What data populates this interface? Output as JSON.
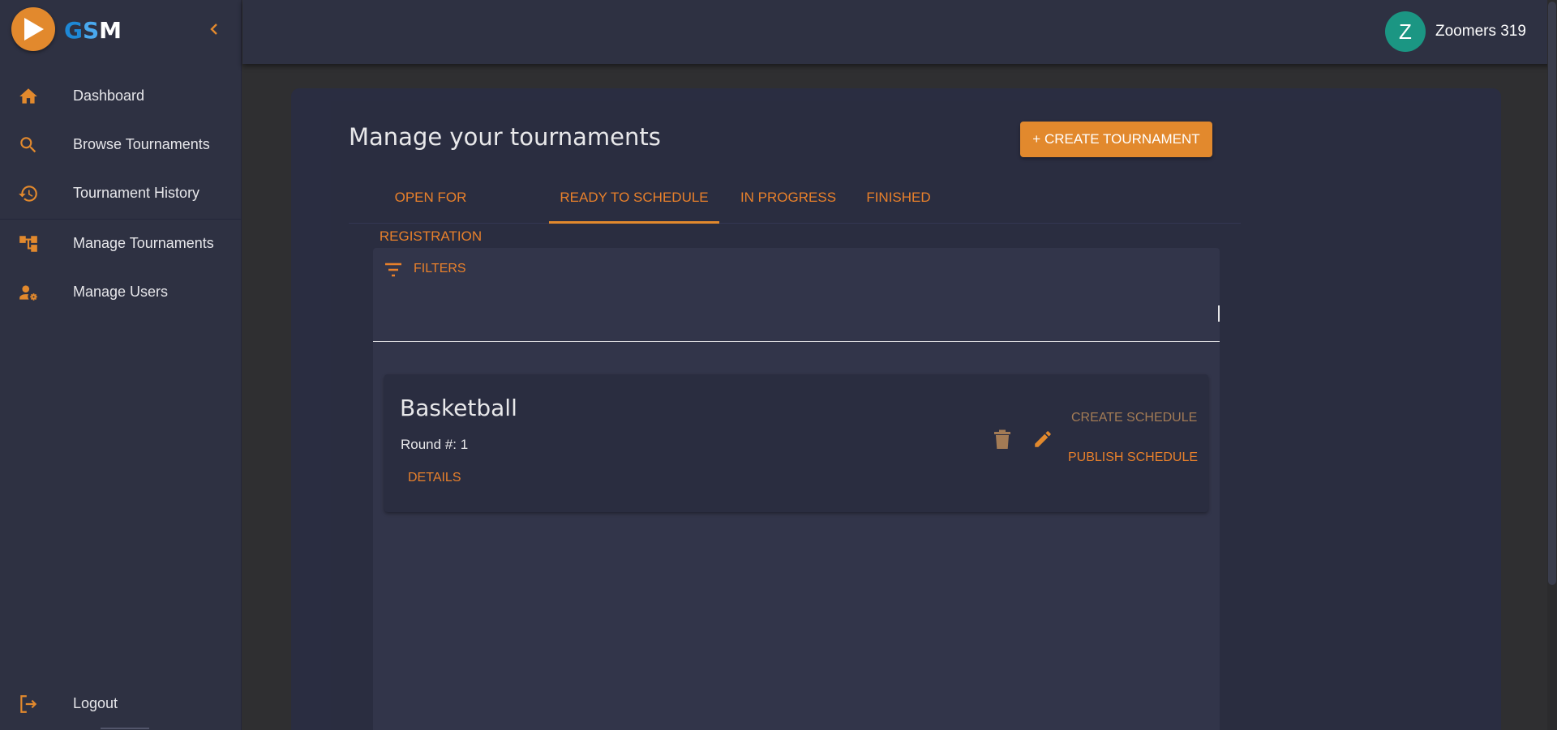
{
  "brand": {
    "letter_g": "G",
    "letter_s": "S",
    "letter_m": "M",
    "accent_color": "#e2892d"
  },
  "sidebar": {
    "items": [
      {
        "label": "Dashboard",
        "icon": "home-icon"
      },
      {
        "label": "Browse Tournaments",
        "icon": "search-icon"
      },
      {
        "label": "Tournament History",
        "icon": "history-icon"
      },
      {
        "label": "Manage Tournaments",
        "icon": "tree-icon"
      },
      {
        "label": "Manage Users",
        "icon": "user-gear-icon"
      }
    ],
    "logout_label": "Logout"
  },
  "user": {
    "initial": "Z",
    "name": "Zoomers 319",
    "avatar_color": "#1b9683"
  },
  "main": {
    "title": "Manage your tournaments",
    "create_button": "+ CREATE TOURNAMENT",
    "tabs": [
      {
        "label": "OPEN FOR REGISTRATION"
      },
      {
        "label": "READY TO SCHEDULE"
      },
      {
        "label": "IN PROGRESS"
      },
      {
        "label": "FINISHED"
      }
    ],
    "active_tab": "READY TO SCHEDULE",
    "filters_label": "FILTERS"
  },
  "tournaments": [
    {
      "name": "Basketball",
      "round": "Round #: 1",
      "details_label": "DETAILS",
      "create_schedule_label": "CREATE SCHEDULE",
      "publish_schedule_label": "PUBLISH SCHEDULE"
    }
  ]
}
